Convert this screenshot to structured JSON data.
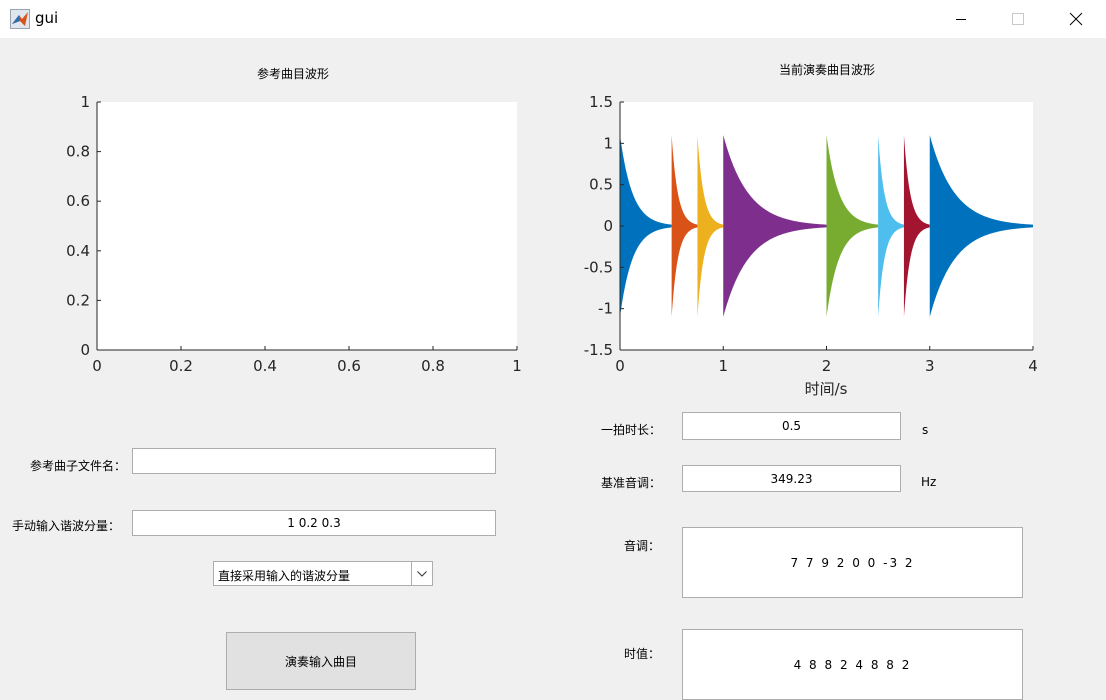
{
  "window": {
    "title": "gui",
    "icon": "matlab-icon"
  },
  "axes_left": {
    "title": "参考曲目波形",
    "xticks": [
      "0",
      "0.2",
      "0.4",
      "0.6",
      "0.8",
      "1"
    ],
    "yticks": [
      "0",
      "0.2",
      "0.4",
      "0.6",
      "0.8",
      "1"
    ]
  },
  "axes_right": {
    "title": "当前演奏曲目波形",
    "xlabel": "时间/s",
    "xticks": [
      "0",
      "1",
      "2",
      "3",
      "4"
    ],
    "yticks": [
      "-1.5",
      "-1",
      "-0.5",
      "0",
      "0.5",
      "1",
      "1.5"
    ]
  },
  "chart_data": {
    "type": "line",
    "title": "当前演奏曲目波形",
    "xlabel": "时间/s",
    "ylabel": "",
    "xlim": [
      0,
      4
    ],
    "ylim": [
      -1.5,
      1.5
    ],
    "grid": false,
    "series": [
      {
        "start": 0.0,
        "end": 0.5,
        "peak": 1.1,
        "color": "#0072BD"
      },
      {
        "start": 0.5,
        "end": 0.75,
        "peak": 1.1,
        "color": "#D95319"
      },
      {
        "start": 0.75,
        "end": 1.0,
        "peak": 1.1,
        "color": "#EDB120"
      },
      {
        "start": 1.0,
        "end": 2.0,
        "peak": 1.1,
        "color": "#7E2F8E"
      },
      {
        "start": 2.0,
        "end": 2.5,
        "peak": 1.1,
        "color": "#77AC30"
      },
      {
        "start": 2.5,
        "end": 2.75,
        "peak": 1.1,
        "color": "#4DBEEE"
      },
      {
        "start": 2.75,
        "end": 3.0,
        "peak": 1.1,
        "color": "#A2142F"
      },
      {
        "start": 3.0,
        "end": 4.0,
        "peak": 1.1,
        "color": "#0072BD"
      }
    ]
  },
  "form": {
    "beat_label": "一拍时长：",
    "beat_value": "0.5",
    "beat_unit": "s",
    "base_label": "基准音调：",
    "base_value": "349.23",
    "base_unit": "Hz",
    "pitch_label": "音调：",
    "pitch_value": "7 7 9 2 0 0 -3 2",
    "duration_label": "时值：",
    "duration_value": "4 8 8 2 4 8 8 2",
    "ref_file_label": "参考曲子文件名：",
    "ref_file_value": "",
    "harmonic_label": "手动输入谐波分量：",
    "harmonic_value": "1 0.2 0.3",
    "mode_selected": "直接采用输入的谐波分量",
    "play_button": "演奏输入曲目"
  }
}
